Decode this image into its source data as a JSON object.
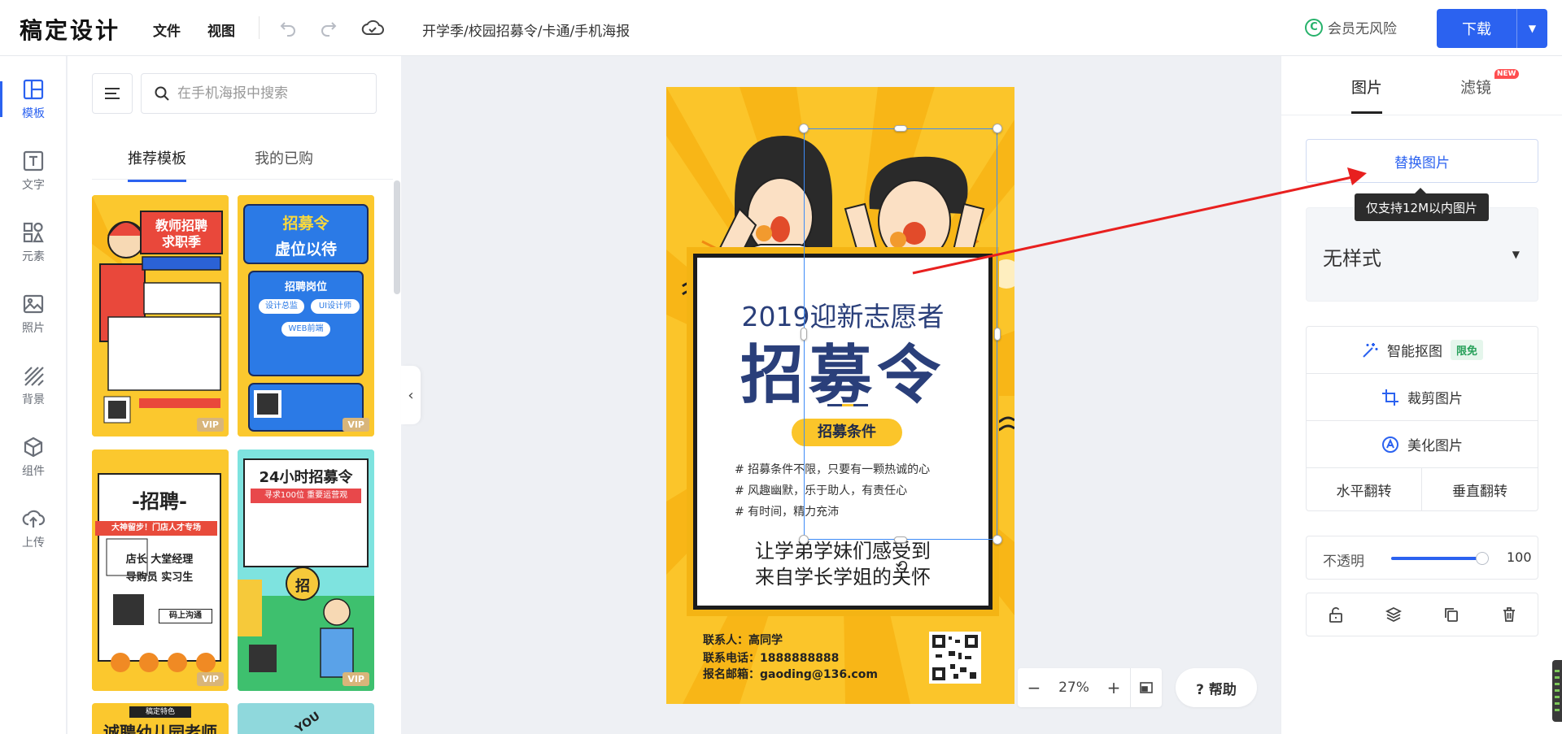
{
  "header": {
    "logo": "稿定设计",
    "menu": [
      "文件",
      "视图"
    ],
    "breadcrumb": "开学季/校园招募令/卡通/手机海报",
    "vip_text": "会员无风险",
    "vip_mark": "C",
    "download_label": "下载"
  },
  "rail": {
    "items": [
      {
        "label": "模板",
        "icon": "template-icon",
        "active": true
      },
      {
        "label": "文字",
        "icon": "text-icon"
      },
      {
        "label": "元素",
        "icon": "elements-icon"
      },
      {
        "label": "照片",
        "icon": "photo-icon"
      },
      {
        "label": "背景",
        "icon": "background-icon"
      },
      {
        "label": "组件",
        "icon": "component-icon"
      },
      {
        "label": "上传",
        "icon": "upload-icon"
      }
    ]
  },
  "template_panel": {
    "search_placeholder": "在手机海报中搜索",
    "tabs": [
      "推荐模板",
      "我的已购"
    ],
    "active_tab": "推荐模板",
    "vip_label": "VIP",
    "thumbnails": [
      {
        "title": "教师招聘",
        "subtitle": "求职季"
      },
      {
        "title": "招募令",
        "subtitle": "虚位以待",
        "section": "招聘岗位",
        "roles": [
          "设计总监",
          "UI设计师",
          "WEB前端"
        ]
      },
      {
        "title": "-招聘-",
        "banner": "大神留步！门店人才专场",
        "roles": [
          "店长  大堂经理",
          "导购员  实习生"
        ],
        "button": "码上沟通"
      },
      {
        "title": "24小时招募令",
        "subtitle": "寻求100位 重要运营观",
        "badge": "招"
      },
      {
        "title": "诚聘幼儿园老师",
        "tag": "稿定特色"
      },
      {
        "title": "YOU"
      }
    ]
  },
  "poster": {
    "heading": "2019迎新志愿者",
    "title": "招募令",
    "pill": "招募条件",
    "conditions": [
      "# 招募条件不限，只要有一颗热诚的心",
      "# 风趣幽默，乐于助人，有责任心",
      "# 有时间，精力充沛"
    ],
    "footer_lines": [
      "让学弟学妹们感受到",
      "来自学长学姐的关怀"
    ],
    "contact": [
      "联系人：高同学",
      "联系电话：1888888888",
      "报名邮箱：gaoding@136.com"
    ]
  },
  "canvas_controls": {
    "zoom": "27%",
    "minus": "−",
    "plus": "+",
    "help": "? 帮助"
  },
  "right_panel": {
    "tabs": [
      "图片",
      "滤镜"
    ],
    "active_tab": "图片",
    "new_badge": "NEW",
    "replace_label": "替换图片",
    "tooltip": "仅支持12M以内图片",
    "style_value": "无样式",
    "tools": [
      {
        "label": "智能抠图",
        "icon": "magic-wand-icon",
        "badge": "限免"
      },
      {
        "label": "裁剪图片",
        "icon": "crop-icon"
      },
      {
        "label": "美化图片",
        "icon": "beautify-icon"
      }
    ],
    "flip_horizontal": "水平翻转",
    "flip_vertical": "垂直翻转",
    "opacity_label": "不透明",
    "opacity_value": "100",
    "opacity_level": 1.0,
    "action_icons": [
      "unlock-icon",
      "layers-icon",
      "copy-icon",
      "delete-icon"
    ]
  },
  "colors": {
    "accent": "#2b62f0",
    "poster_yellow": "#fbc52a",
    "poster_navy": "#2a3f7a",
    "annotation_arrow": "#e8201f"
  }
}
